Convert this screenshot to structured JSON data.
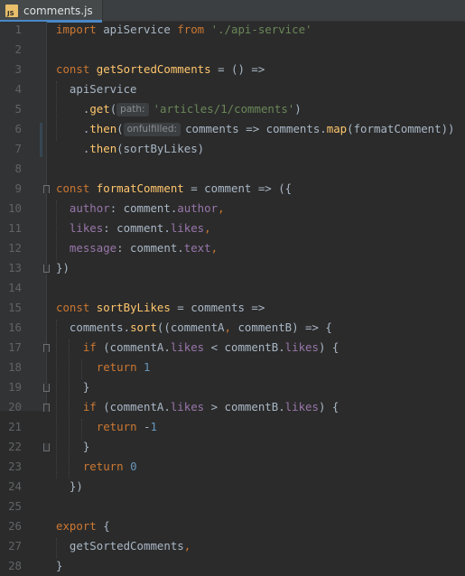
{
  "tab": {
    "label": "comments.js",
    "icon": "js-file-icon",
    "icon_text": "JS"
  },
  "colors": {
    "background": "#2b2b2b",
    "keyword": "#cc7832",
    "function": "#ffc66d",
    "string": "#6a8759",
    "property": "#9876aa",
    "number": "#6897bb",
    "text": "#a9b7c6"
  },
  "lines": [
    {
      "n": "1",
      "indent": "",
      "tokens": [
        [
          "kw",
          "import"
        ],
        [
          "t",
          " apiService "
        ],
        [
          "kw",
          "from"
        ],
        [
          "t",
          " "
        ],
        [
          "str",
          "'./api-service'"
        ]
      ]
    },
    {
      "n": "2",
      "indent": "",
      "tokens": []
    },
    {
      "n": "3",
      "indent": "",
      "tokens": [
        [
          "kw",
          "const"
        ],
        [
          "t",
          " "
        ],
        [
          "fn",
          "getSortedComments"
        ],
        [
          "t",
          " = () =>"
        ]
      ]
    },
    {
      "n": "4",
      "indent": "  ",
      "tokens": [
        [
          "t",
          "apiService"
        ]
      ]
    },
    {
      "n": "5",
      "indent": "    ",
      "tokens": [
        [
          "t",
          "."
        ],
        [
          "fn",
          "get"
        ],
        [
          "t",
          "("
        ],
        [
          "hint",
          "path:"
        ],
        [
          "str",
          "'articles/1/comments'"
        ],
        [
          "t",
          ")"
        ]
      ]
    },
    {
      "n": "6",
      "indent": "    ",
      "tokens": [
        [
          "t",
          "."
        ],
        [
          "fn",
          "then"
        ],
        [
          "t",
          "("
        ],
        [
          "hint",
          "onfulfilled:"
        ],
        [
          "t",
          "comments => comments."
        ],
        [
          "fn",
          "map"
        ],
        [
          "t",
          "(formatComment))"
        ]
      ]
    },
    {
      "n": "7",
      "indent": "    ",
      "tokens": [
        [
          "t",
          "."
        ],
        [
          "fn",
          "then"
        ],
        [
          "t",
          "(sortByLikes)"
        ]
      ]
    },
    {
      "n": "8",
      "indent": "",
      "tokens": []
    },
    {
      "n": "9",
      "indent": "",
      "tokens": [
        [
          "kw",
          "const"
        ],
        [
          "t",
          " "
        ],
        [
          "fn",
          "formatComment"
        ],
        [
          "t",
          " = comment => ({"
        ]
      ]
    },
    {
      "n": "10",
      "indent": "  ",
      "tokens": [
        [
          "prop",
          "author"
        ],
        [
          "t",
          ": comment."
        ],
        [
          "prop",
          "author"
        ],
        [
          "kw",
          ","
        ]
      ]
    },
    {
      "n": "11",
      "indent": "  ",
      "tokens": [
        [
          "prop",
          "likes"
        ],
        [
          "t",
          ": comment."
        ],
        [
          "prop",
          "likes"
        ],
        [
          "kw",
          ","
        ]
      ]
    },
    {
      "n": "12",
      "indent": "  ",
      "tokens": [
        [
          "prop",
          "message"
        ],
        [
          "t",
          ": comment."
        ],
        [
          "prop",
          "text"
        ],
        [
          "kw",
          ","
        ]
      ]
    },
    {
      "n": "13",
      "indent": "",
      "tokens": [
        [
          "t",
          "})"
        ]
      ]
    },
    {
      "n": "14",
      "indent": "",
      "tokens": []
    },
    {
      "n": "15",
      "indent": "",
      "tokens": [
        [
          "kw",
          "const"
        ],
        [
          "t",
          " "
        ],
        [
          "fn",
          "sortByLikes"
        ],
        [
          "t",
          " = comments =>"
        ]
      ]
    },
    {
      "n": "16",
      "indent": "  ",
      "tokens": [
        [
          "t",
          "comments."
        ],
        [
          "fn",
          "sort"
        ],
        [
          "t",
          "((commentA"
        ],
        [
          "kw",
          ","
        ],
        [
          "t",
          " commentB) => {"
        ]
      ]
    },
    {
      "n": "17",
      "indent": "    ",
      "tokens": [
        [
          "kw",
          "if"
        ],
        [
          "t",
          " (commentA."
        ],
        [
          "prop",
          "likes"
        ],
        [
          "t",
          " < commentB."
        ],
        [
          "prop",
          "likes"
        ],
        [
          "t",
          ") {"
        ]
      ]
    },
    {
      "n": "18",
      "indent": "      ",
      "tokens": [
        [
          "kw",
          "return"
        ],
        [
          "t",
          " "
        ],
        [
          "num",
          "1"
        ]
      ]
    },
    {
      "n": "19",
      "indent": "    ",
      "tokens": [
        [
          "t",
          "}"
        ]
      ]
    },
    {
      "n": "20",
      "indent": "    ",
      "tokens": [
        [
          "kw",
          "if"
        ],
        [
          "t",
          " (commentA."
        ],
        [
          "prop",
          "likes"
        ],
        [
          "t",
          " > commentB."
        ],
        [
          "prop",
          "likes"
        ],
        [
          "t",
          ") {"
        ]
      ]
    },
    {
      "n": "21",
      "indent": "      ",
      "tokens": [
        [
          "kw",
          "return"
        ],
        [
          "t",
          " -"
        ],
        [
          "num",
          "1"
        ]
      ]
    },
    {
      "n": "22",
      "indent": "    ",
      "tokens": [
        [
          "t",
          "}"
        ]
      ]
    },
    {
      "n": "23",
      "indent": "    ",
      "tokens": [
        [
          "kw",
          "return"
        ],
        [
          "t",
          " "
        ],
        [
          "num",
          "0"
        ]
      ]
    },
    {
      "n": "24",
      "indent": "  ",
      "tokens": [
        [
          "t",
          "})"
        ]
      ]
    },
    {
      "n": "25",
      "indent": "",
      "tokens": []
    },
    {
      "n": "26",
      "indent": "",
      "tokens": [
        [
          "kw",
          "export"
        ],
        [
          "t",
          " {"
        ]
      ]
    },
    {
      "n": "27",
      "indent": "  ",
      "tokens": [
        [
          "t",
          "getSortedComments"
        ],
        [
          "kw",
          ","
        ]
      ]
    },
    {
      "n": "28",
      "indent": "",
      "tokens": [
        [
          "t",
          "}"
        ]
      ]
    }
  ]
}
